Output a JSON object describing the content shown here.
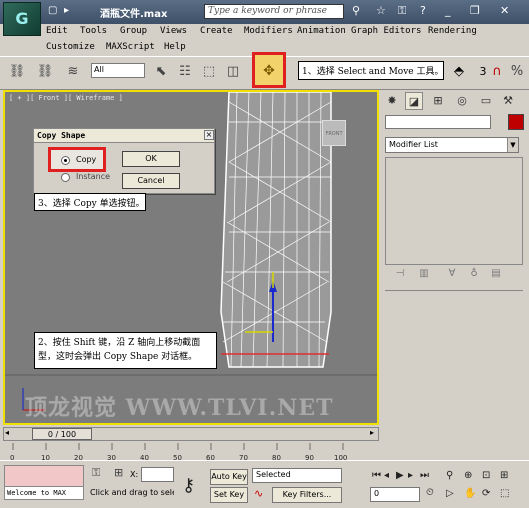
{
  "app": {
    "logo": "G",
    "title": "酒瓶文件.max",
    "search_placeholder": "Type a keyword or phrase"
  },
  "menu": [
    "Edit",
    "Tools",
    "Group",
    "Views",
    "Create",
    "Modifiers",
    "Animation",
    "Graph Editors",
    "Rendering",
    "Customize",
    "MAXScript",
    "Help"
  ],
  "toolbar": {
    "filter_value": "All",
    "snap_num": "3"
  },
  "callouts": {
    "step1": "1、选择 Select and Move 工具。",
    "step2": "2、按住 Shift 键，沿 Z 轴向上移动截面型，这时会弹出 Copy Shape 对话框。",
    "step3": "3、选择 Copy 单选按钮。"
  },
  "viewport": {
    "label": "[ + ][ Front ][ Wireframe ]",
    "cube_label": "FRONT",
    "watermark": "顶龙视觉 WWW.TLVI.NET"
  },
  "dialog": {
    "title": "Copy Shape",
    "close": "×",
    "option_copy": "Copy",
    "option_instance": "Instance",
    "ok": "OK",
    "cancel": "Cancel",
    "selected": "Copy"
  },
  "cmdpanel": {
    "modifier_list": "Modifier List",
    "color": "#bf0000"
  },
  "timeline": {
    "frame": "0 / 100",
    "ticks": [
      "0",
      "10",
      "20",
      "30",
      "40",
      "50",
      "60",
      "70",
      "80",
      "90",
      "100"
    ]
  },
  "status": {
    "welcome": "Welcome to MAX",
    "prompt": "Click and drag to sele",
    "x_label": "X:",
    "auto_key": "Auto Key",
    "set_key": "Set Key",
    "selected": "Selected",
    "key_filters": "Key Filters...",
    "frame_field": "0"
  }
}
